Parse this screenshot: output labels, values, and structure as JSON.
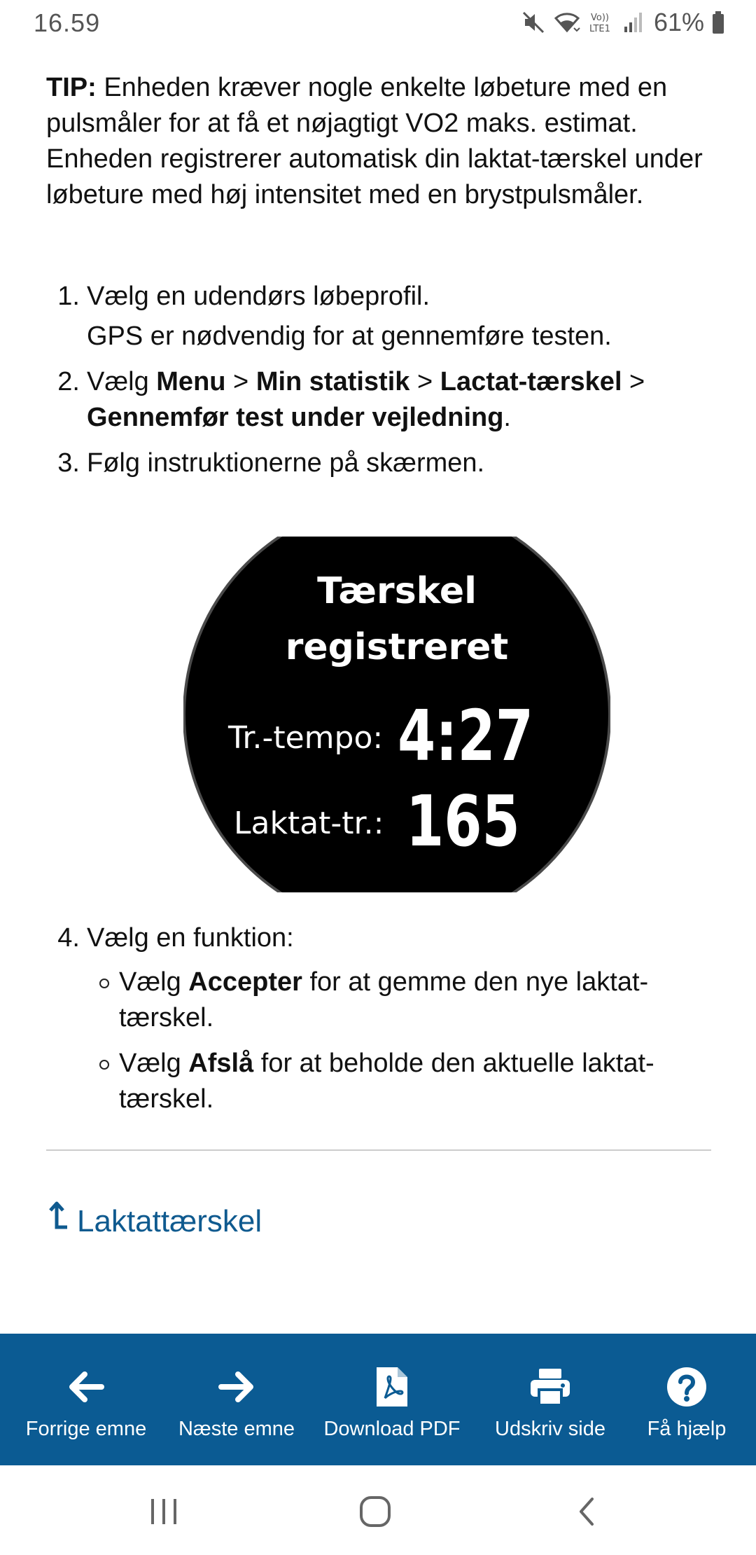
{
  "status_bar": {
    "time": "16.59",
    "battery": "61%",
    "network": "VoLTE1",
    "icons": [
      "mute-icon",
      "wifi-icon",
      "volte-icon",
      "signal-icon",
      "battery-icon"
    ]
  },
  "tip": {
    "label": "TIP:",
    "text": " Enheden kræver nogle enkelte løbeture med en pulsmåler for at få et nøjagtigt VO2 maks. estimat. Enheden registrerer automatisk din laktat-tærskel under løbeture med høj intensitet med en brystpulsmåler."
  },
  "steps": [
    {
      "num": "1.",
      "text": "Vælg en udendørs løbeprofil.",
      "sub": "GPS er nødvendig for at gennemføre testen."
    },
    {
      "num": "2.",
      "pre": "Vælg ",
      "menu": "Menu",
      "sep1": " > ",
      "stats": "Min statistik",
      "sep2": " > ",
      "lactate": "Lactat-tærskel",
      "sep3": " > ",
      "guided": "Gennemfør test under vejledning",
      "post": "."
    },
    {
      "num": "3.",
      "text": "Følg instruktionerne på skærmen."
    },
    {
      "num": "4.",
      "text": "Vælg en funktion:"
    }
  ],
  "watch": {
    "title_line1": "Tærskel",
    "title_line2": "registreret",
    "tempo_label": "Tr.-tempo:",
    "tempo_value": "4:27",
    "lactate_label": "Laktat-tr.:",
    "lactate_value": "165"
  },
  "options": [
    {
      "pre": "Vælg ",
      "bold": "Accepter",
      "post": " for at gemme den nye laktat-tærskel."
    },
    {
      "pre": "Vælg ",
      "bold": "Afslå",
      "post": " for at beholde den aktuelle laktat-tærskel."
    }
  ],
  "parent_link": {
    "label": "Laktattærskel",
    "icon": "up-arrow-icon"
  },
  "toolbar": {
    "color": "#0b5b93",
    "items": [
      {
        "label": "Forrige emne",
        "icon": "arrow-left-icon"
      },
      {
        "label": "Næste emne",
        "icon": "arrow-right-icon"
      },
      {
        "label": "Download PDF",
        "icon": "pdf-icon"
      },
      {
        "label": "Udskriv side",
        "icon": "printer-icon"
      },
      {
        "label": "Få hjælp",
        "icon": "help-icon"
      }
    ]
  },
  "nav_bar": {
    "buttons": [
      "recent-apps-icon",
      "home-icon",
      "back-icon"
    ]
  }
}
